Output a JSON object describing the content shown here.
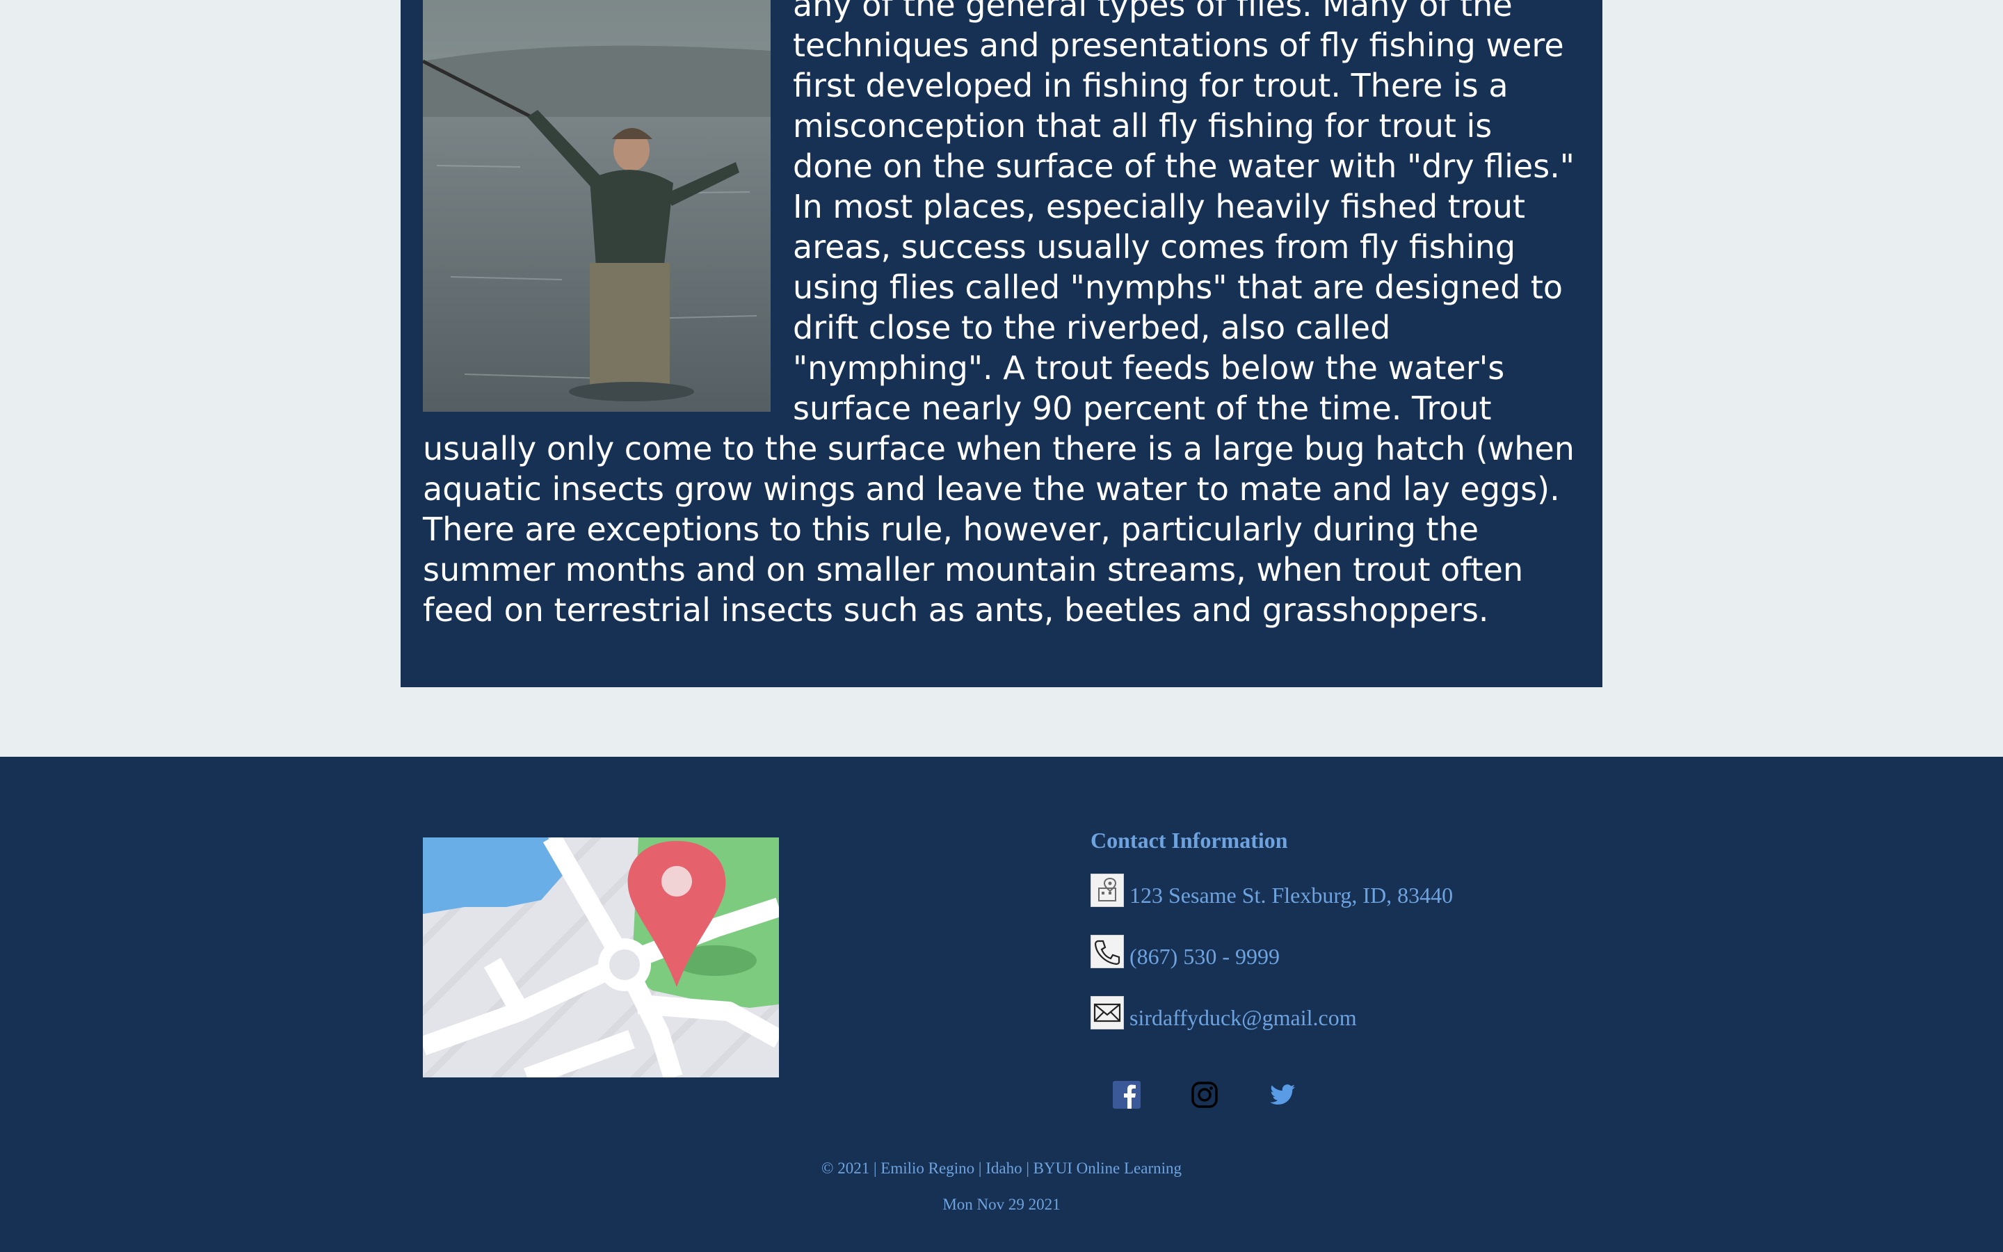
{
  "article": {
    "text": "any of the general types of flies. Many of the techniques and presentations of fly fishing were first developed in fishing for trout. There is a misconception that all fly fishing for trout is done on the surface of the water with \"dry flies.\" In most places, especially heavily fished trout areas, success usually comes from fly fishing using flies called \"nymphs\" that are designed to drift close to the riverbed, also called \"nymphing\". A trout feeds below the water's surface nearly 90 percent of the time. Trout usually only come to the surface when there is a large bug hatch (when aquatic insects grow wings and leave the water to mate and lay eggs). There are exceptions to this rule, however, particularly during the summer months and on smaller mountain streams, when trout often feed on terrestrial insects such as ants, beetles and grasshoppers."
  },
  "contact": {
    "heading": "Contact Information",
    "address": "123 Sesame St. Flexburg, ID, 83440",
    "phone": "(867) 530 - 9999",
    "email": "sirdaffyduck@gmail.com"
  },
  "icons": {
    "address": "location-building-icon",
    "phone": "phone-icon",
    "email": "envelope-icon",
    "socials": [
      "facebook-icon",
      "instagram-icon",
      "twitter-icon"
    ]
  },
  "footer": {
    "copyright": "© 2021 | Emilio Regino | Idaho | BYUI Online Learning",
    "date": "Mon Nov 29 2021"
  },
  "colors": {
    "navy": "#163154",
    "page_bg": "#e9eff1",
    "link_blue": "#6ea3df"
  }
}
